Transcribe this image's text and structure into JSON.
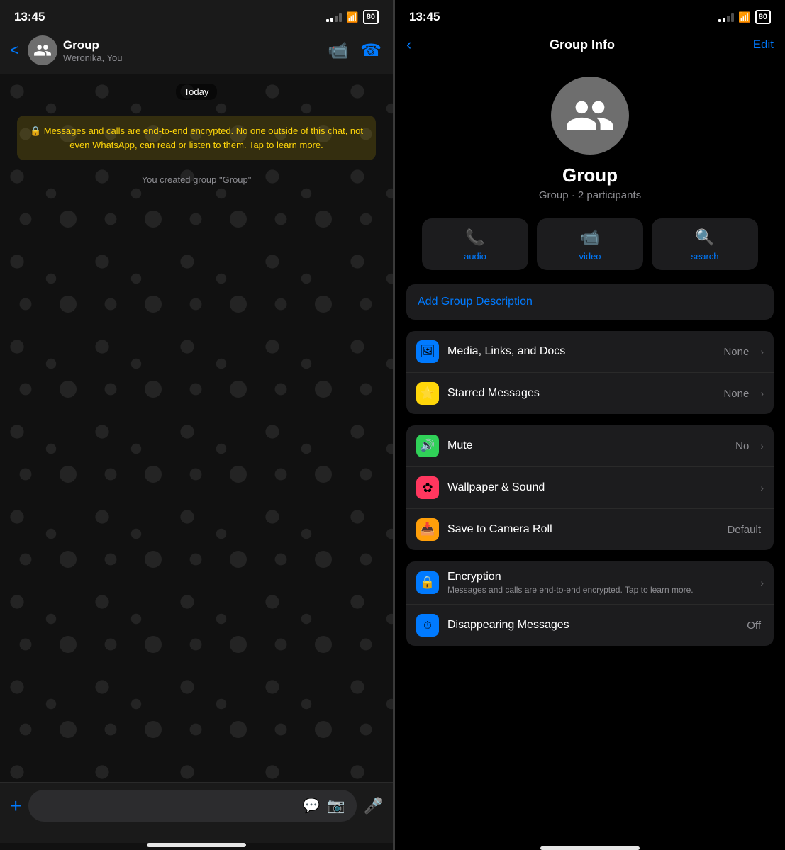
{
  "left": {
    "status_time": "13:45",
    "battery": "80",
    "chat_header": {
      "group_name": "Group",
      "members": "Weronika, You"
    },
    "date_label": "Today",
    "encryption_message": "🔒 Messages and calls are end-to-end encrypted. No one outside of this chat, not even WhatsApp, can read or listen to them. Tap to learn more.",
    "system_message": "You created group \"Group\"",
    "input_placeholder": ""
  },
  "right": {
    "status_time": "13:45",
    "battery": "80",
    "header": {
      "back_label": "‹",
      "title": "Group Info",
      "edit_label": "Edit"
    },
    "group_name": "Group",
    "group_sub": "Group · 2 participants",
    "actions": [
      {
        "id": "audio",
        "icon": "📞",
        "label": "audio"
      },
      {
        "id": "video",
        "icon": "📹",
        "label": "video"
      },
      {
        "id": "search",
        "icon": "🔍",
        "label": "search"
      }
    ],
    "description_label": "Add Group Description",
    "settings_rows_1": [
      {
        "id": "media",
        "icon": "🖼",
        "icon_color": "blue",
        "label": "Media, Links, and Docs",
        "value": "None",
        "has_chevron": true
      },
      {
        "id": "starred",
        "icon": "⭐",
        "icon_color": "yellow",
        "label": "Starred Messages",
        "value": "None",
        "has_chevron": true
      }
    ],
    "settings_rows_2": [
      {
        "id": "mute",
        "icon": "🔊",
        "icon_color": "green",
        "label": "Mute",
        "value": "No",
        "has_chevron": true
      },
      {
        "id": "wallpaper",
        "icon": "✿",
        "icon_color": "pink",
        "label": "Wallpaper & Sound",
        "value": "",
        "has_chevron": true
      },
      {
        "id": "camera-roll",
        "icon": "📥",
        "icon_color": "orange",
        "label": "Save to Camera Roll",
        "value": "Default",
        "has_chevron": false
      }
    ],
    "settings_rows_3": [
      {
        "id": "encryption",
        "icon": "🔒",
        "icon_color": "blue",
        "label": "Encryption",
        "sublabel": "Messages and calls are end-to-end encrypted. Tap to learn more.",
        "value": "",
        "has_chevron": true
      },
      {
        "id": "disappearing",
        "icon": "⏱",
        "icon_color": "blue",
        "label": "Disappearing Messages",
        "sublabel": "",
        "value": "Off",
        "has_chevron": false
      }
    ]
  }
}
